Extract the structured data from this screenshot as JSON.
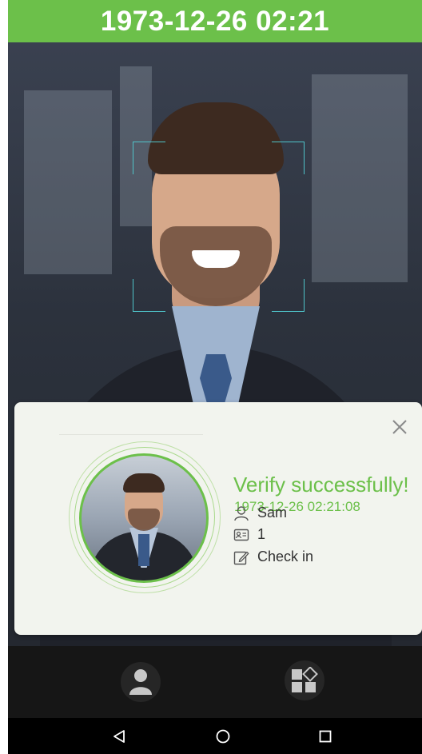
{
  "status_bar": {
    "datetime": "1973-12-26 02:21"
  },
  "result_card": {
    "title": "Verify successfully!",
    "timestamp": "1973-12-26 02:21:08",
    "user_name": "Sam",
    "user_id": "1",
    "attendance_state": "Check in",
    "close_icon": "close-icon"
  },
  "toolbar": {
    "user_button_icon": "user-icon",
    "menu_button_icon": "apps-icon"
  },
  "navigation": {
    "back_icon": "back-triangle-icon",
    "home_icon": "home-circle-icon",
    "recent_icon": "recent-square-icon"
  },
  "colors": {
    "accent": "#6cc04a",
    "face_frame": "#4fc3c9",
    "card_bg": "#f2f4ee"
  }
}
